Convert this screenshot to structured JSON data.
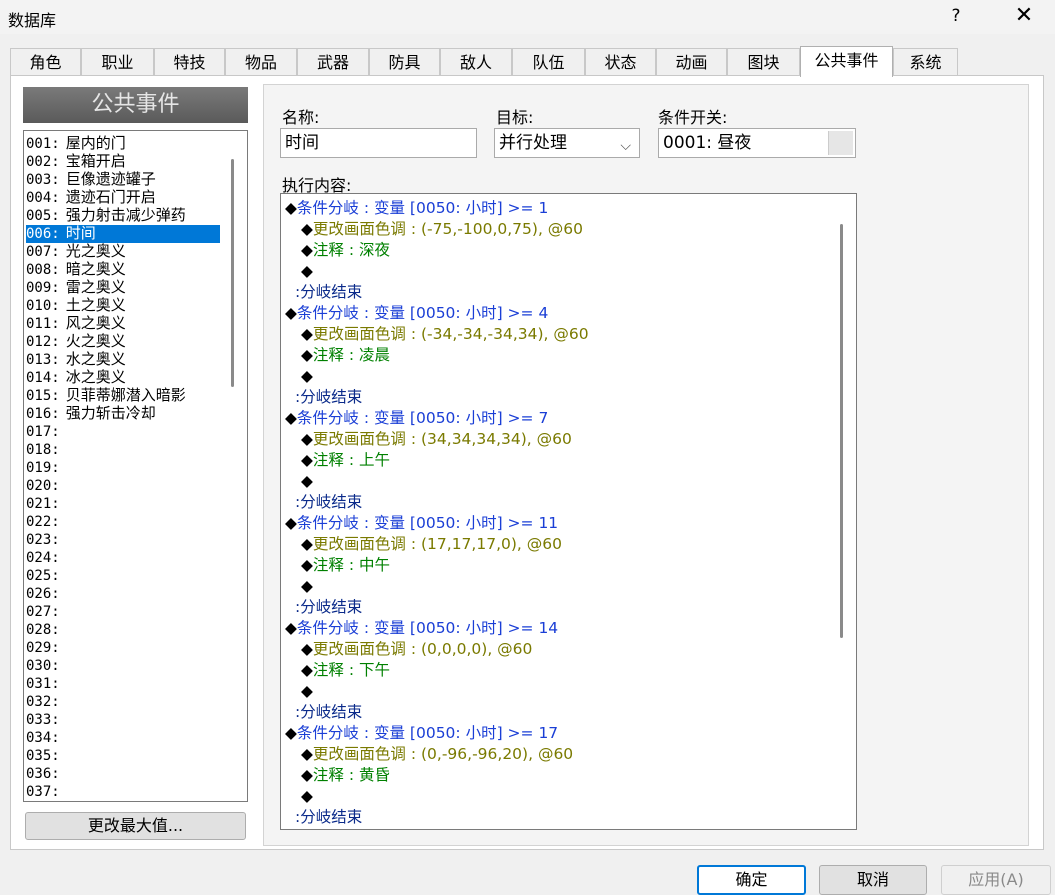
{
  "window": {
    "title": "数据库",
    "help_label": "?",
    "close_label": "✕"
  },
  "tabs": [
    "角色",
    "职业",
    "特技",
    "物品",
    "武器",
    "防具",
    "敌人",
    "队伍",
    "状态",
    "动画",
    "图块",
    "公共事件",
    "系统"
  ],
  "active_tab": "公共事件",
  "list": {
    "header": "公共事件",
    "items": [
      {
        "num": "001:",
        "name": "屋内的门"
      },
      {
        "num": "002:",
        "name": "宝箱开启"
      },
      {
        "num": "003:",
        "name": "巨像遗迹罐子"
      },
      {
        "num": "004:",
        "name": "遗迹石门开启"
      },
      {
        "num": "005:",
        "name": "强力射击减少弹药"
      },
      {
        "num": "006:",
        "name": "时间"
      },
      {
        "num": "007:",
        "name": "光之奥义"
      },
      {
        "num": "008:",
        "name": "暗之奥义"
      },
      {
        "num": "009:",
        "name": "雷之奥义"
      },
      {
        "num": "010:",
        "name": "土之奥义"
      },
      {
        "num": "011:",
        "name": "风之奥义"
      },
      {
        "num": "012:",
        "name": "火之奥义"
      },
      {
        "num": "013:",
        "name": "水之奥义"
      },
      {
        "num": "014:",
        "name": "冰之奥义"
      },
      {
        "num": "015:",
        "name": "贝菲蒂娜潜入暗影"
      },
      {
        "num": "016:",
        "name": "强力斩击冷却"
      },
      {
        "num": "017:",
        "name": ""
      },
      {
        "num": "018:",
        "name": ""
      },
      {
        "num": "019:",
        "name": ""
      },
      {
        "num": "020:",
        "name": ""
      },
      {
        "num": "021:",
        "name": ""
      },
      {
        "num": "022:",
        "name": ""
      },
      {
        "num": "023:",
        "name": ""
      },
      {
        "num": "024:",
        "name": ""
      },
      {
        "num": "025:",
        "name": ""
      },
      {
        "num": "026:",
        "name": ""
      },
      {
        "num": "027:",
        "name": ""
      },
      {
        "num": "028:",
        "name": ""
      },
      {
        "num": "029:",
        "name": ""
      },
      {
        "num": "030:",
        "name": ""
      },
      {
        "num": "031:",
        "name": ""
      },
      {
        "num": "032:",
        "name": ""
      },
      {
        "num": "033:",
        "name": ""
      },
      {
        "num": "034:",
        "name": ""
      },
      {
        "num": "035:",
        "name": ""
      },
      {
        "num": "036:",
        "name": ""
      },
      {
        "num": "037:",
        "name": ""
      }
    ],
    "selected_index": 5,
    "change_max_label": "更改最大值..."
  },
  "form": {
    "name_label": "名称:",
    "name_value": "时间",
    "trigger_label": "目标:",
    "trigger_value": "并行处理",
    "switch_label": "条件开关:",
    "switch_value": "0001: 昼夜",
    "content_label": "执行内容:"
  },
  "commands": [
    {
      "indent": 0,
      "prefix": "◆",
      "text": "条件分岐 : 变量 [0050: 小时] >= 1",
      "color": "blue"
    },
    {
      "indent": 1,
      "prefix": "◆",
      "text": "更改画面色调 : (-75,-100,0,75), @60",
      "color": "olive"
    },
    {
      "indent": 1,
      "prefix": "◆",
      "text": "注释 : 深夜",
      "color": "green"
    },
    {
      "indent": 1,
      "prefix": "◆",
      "text": "",
      "color": "black"
    },
    {
      "indent": 0,
      "prefix": "",
      "text": ":分岐结束",
      "color": "navy"
    },
    {
      "indent": 0,
      "prefix": "◆",
      "text": "条件分岐 : 变量 [0050: 小时] >= 4",
      "color": "blue"
    },
    {
      "indent": 1,
      "prefix": "◆",
      "text": "更改画面色调 : (-34,-34,-34,34), @60",
      "color": "olive"
    },
    {
      "indent": 1,
      "prefix": "◆",
      "text": "注释 : 凌晨",
      "color": "green"
    },
    {
      "indent": 1,
      "prefix": "◆",
      "text": "",
      "color": "black"
    },
    {
      "indent": 0,
      "prefix": "",
      "text": ":分岐结束",
      "color": "navy"
    },
    {
      "indent": 0,
      "prefix": "◆",
      "text": "条件分岐 : 变量 [0050: 小时] >= 7",
      "color": "blue"
    },
    {
      "indent": 1,
      "prefix": "◆",
      "text": "更改画面色调 : (34,34,34,34), @60",
      "color": "olive"
    },
    {
      "indent": 1,
      "prefix": "◆",
      "text": "注释 : 上午",
      "color": "green"
    },
    {
      "indent": 1,
      "prefix": "◆",
      "text": "",
      "color": "black"
    },
    {
      "indent": 0,
      "prefix": "",
      "text": ":分岐结束",
      "color": "navy"
    },
    {
      "indent": 0,
      "prefix": "◆",
      "text": "条件分岐 : 变量 [0050: 小时] >= 11",
      "color": "blue"
    },
    {
      "indent": 1,
      "prefix": "◆",
      "text": "更改画面色调 : (17,17,17,0), @60",
      "color": "olive"
    },
    {
      "indent": 1,
      "prefix": "◆",
      "text": "注释 : 中午",
      "color": "green"
    },
    {
      "indent": 1,
      "prefix": "◆",
      "text": "",
      "color": "black"
    },
    {
      "indent": 0,
      "prefix": "",
      "text": ":分岐结束",
      "color": "navy"
    },
    {
      "indent": 0,
      "prefix": "◆",
      "text": "条件分岐 : 变量 [0050: 小时] >= 14",
      "color": "blue"
    },
    {
      "indent": 1,
      "prefix": "◆",
      "text": "更改画面色调 : (0,0,0,0), @60",
      "color": "olive"
    },
    {
      "indent": 1,
      "prefix": "◆",
      "text": "注释 : 下午",
      "color": "green"
    },
    {
      "indent": 1,
      "prefix": "◆",
      "text": "",
      "color": "black"
    },
    {
      "indent": 0,
      "prefix": "",
      "text": ":分岐结束",
      "color": "navy"
    },
    {
      "indent": 0,
      "prefix": "◆",
      "text": "条件分岐 : 变量 [0050: 小时] >= 17",
      "color": "blue"
    },
    {
      "indent": 1,
      "prefix": "◆",
      "text": "更改画面色调 : (0,-96,-96,20), @60",
      "color": "olive"
    },
    {
      "indent": 1,
      "prefix": "◆",
      "text": "注释 : 黄昏",
      "color": "green"
    },
    {
      "indent": 1,
      "prefix": "◆",
      "text": "",
      "color": "black"
    },
    {
      "indent": 0,
      "prefix": "",
      "text": ":分岐结束",
      "color": "navy"
    }
  ],
  "buttons": {
    "ok": "确定",
    "cancel": "取消",
    "apply": "应用(A)"
  },
  "colors": {
    "selection": "#0078d7",
    "branch": "#1a3ed6",
    "tint": "#7a7a00",
    "comment": "#008000",
    "branch_end": "#0a2a8a"
  }
}
